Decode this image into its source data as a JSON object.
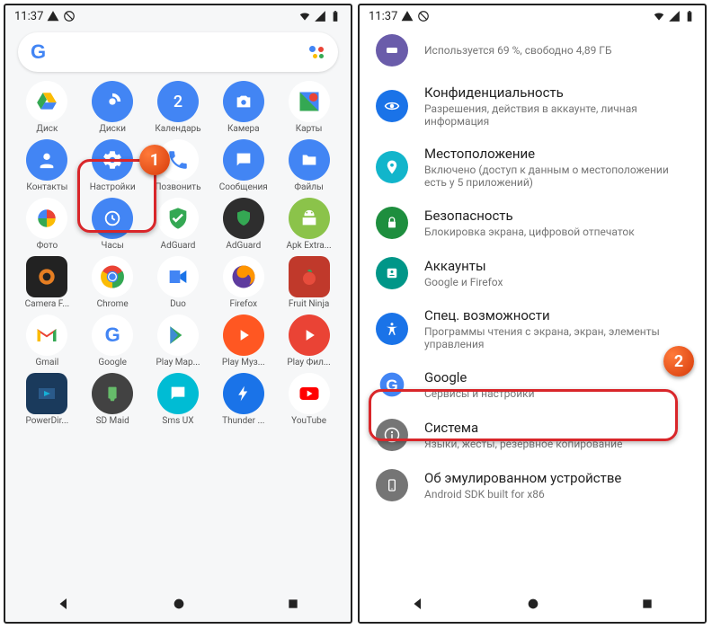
{
  "status": {
    "time": "11:37"
  },
  "annotations": {
    "one": "1",
    "two": "2"
  },
  "left": {
    "apps": [
      {
        "label": "Диск"
      },
      {
        "label": "Диски"
      },
      {
        "label": "Календарь"
      },
      {
        "label": "Камера"
      },
      {
        "label": "Карты"
      },
      {
        "label": "Контакты"
      },
      {
        "label": "Настройки"
      },
      {
        "label": "Позвонить"
      },
      {
        "label": "Сообщения"
      },
      {
        "label": "Файлы"
      },
      {
        "label": "Фото"
      },
      {
        "label": "Часы"
      },
      {
        "label": "AdGuard"
      },
      {
        "label": "AdGuard"
      },
      {
        "label": "Apk Extra..."
      },
      {
        "label": "Camera F..."
      },
      {
        "label": "Chrome"
      },
      {
        "label": "Duo"
      },
      {
        "label": "Firefox"
      },
      {
        "label": "Fruit Ninja"
      },
      {
        "label": "Gmail"
      },
      {
        "label": "Google"
      },
      {
        "label": "Play Мар..."
      },
      {
        "label": "Play Муз..."
      },
      {
        "label": "Play Фил..."
      },
      {
        "label": "PowerDir..."
      },
      {
        "label": "SD Maid"
      },
      {
        "label": "Sms UX"
      },
      {
        "label": "Thunder ..."
      },
      {
        "label": "YouTube"
      }
    ]
  },
  "right": {
    "storage_sub": "Используется 69 %, свободно 4,89 ГБ",
    "items": [
      {
        "title": "Конфиденциальность",
        "sub": "Разрешения, действия в аккаунте, личная информация",
        "bg": "#1a73e8"
      },
      {
        "title": "Местоположение",
        "sub": "Включено (доступ к данным о местоположении есть у 5 приложений)",
        "bg": "#12b5cb"
      },
      {
        "title": "Безопасность",
        "sub": "Блокировка экрана, цифровой отпечаток",
        "bg": "#1e8e3e"
      },
      {
        "title": "Аккаунты",
        "sub": "Google и Firefox",
        "bg": "#009688"
      },
      {
        "title": "Спец. возможности",
        "sub": "Программы чтения с экрана, экран, элементы управления",
        "bg": "#1a73e8"
      },
      {
        "title": "Google",
        "sub": "Сервисы и настройки",
        "bg": "#fff"
      },
      {
        "title": "Система",
        "sub": "Языки, жесты, резервное копирование",
        "bg": "#757575"
      },
      {
        "title": "Об эмулированном устройстве",
        "sub": "Android SDK built for x86",
        "bg": "#757575"
      }
    ]
  }
}
